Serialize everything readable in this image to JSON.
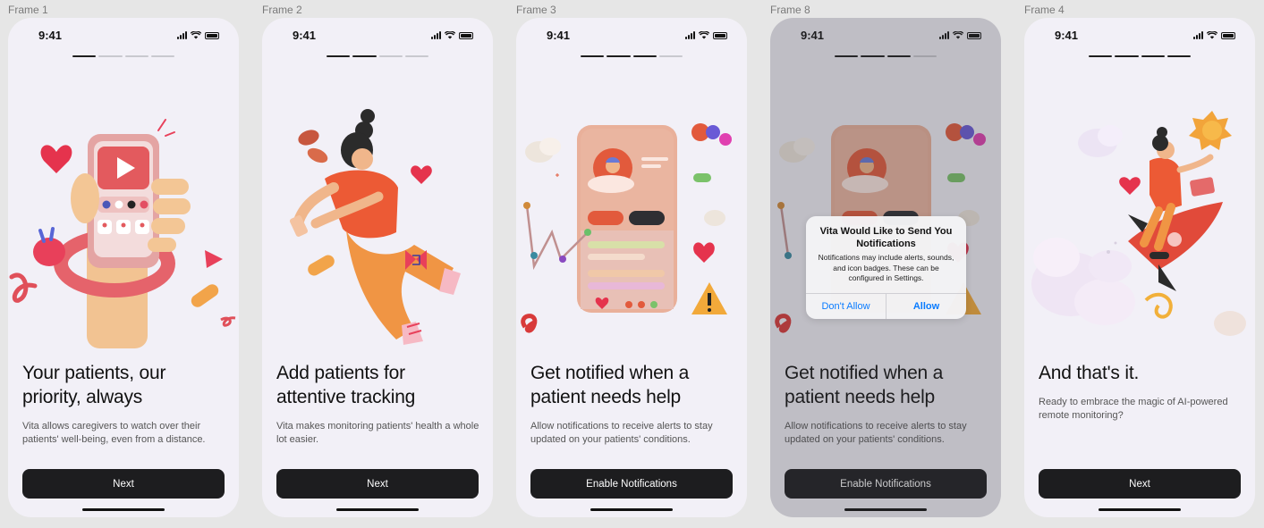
{
  "status_time": "9:41",
  "frames": [
    {
      "label": "Frame 1",
      "title_line1": "Your patients, our",
      "title_line2": "priority, always",
      "description": "Vita allows caregivers to watch over their patients' well-being, even from a distance.",
      "button_label": "Next",
      "progress_active": 1
    },
    {
      "label": "Frame 2",
      "title_line1": "Add patients for",
      "title_line2": "attentive tracking",
      "description": "Vita makes monitoring patients' health a whole lot easier.",
      "button_label": "Next",
      "progress_active": 2
    },
    {
      "label": "Frame 3",
      "title_line1": "Get notified when a",
      "title_line2": "patient needs help",
      "description": "Allow notifications to receive alerts to stay updated on your patients' conditions.",
      "button_label": "Enable Notifications",
      "progress_active": 3
    },
    {
      "label": "Frame 8",
      "title_line1": "Get notified when a",
      "title_line2": "patient needs help",
      "description": "Allow notifications to receive alerts to stay updated on your patients' conditions.",
      "button_label": "Enable Notifications",
      "progress_active": 3
    },
    {
      "label": "Frame 4",
      "title_line1": "And that's it.",
      "title_line2": "",
      "description": "Ready to embrace the magic of AI-powered remote monitoring?",
      "button_label": "Next",
      "progress_active": 4
    }
  ],
  "alert": {
    "title": "Vita Would Like to Send You Notifications",
    "message": "Notifications may include alerts, sounds, and icon badges. These can be configured in Settings.",
    "deny_label": "Don't Allow",
    "allow_label": "Allow"
  },
  "colors": {
    "accent_coral": "#e8564a",
    "accent_blue": "#0a7cff",
    "button_dark": "#1d1d1f",
    "screen_bg": "#f2f0f7"
  }
}
